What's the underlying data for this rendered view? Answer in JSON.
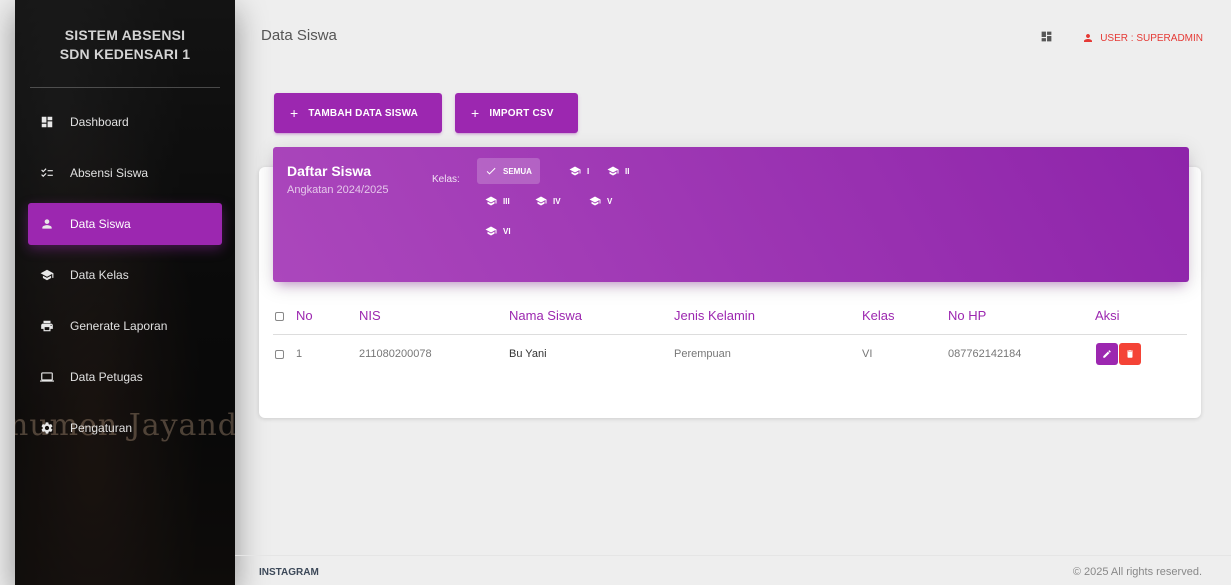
{
  "sidebar": {
    "brand_line1": "SISTEM ABSENSI",
    "brand_line2": "SDN KEDENSARI 1",
    "watermark": "numen Jayand",
    "items": [
      {
        "label": "Dashboard",
        "icon": "dashboard-icon"
      },
      {
        "label": "Absensi Siswa",
        "icon": "checklist-icon"
      },
      {
        "label": "Data Siswa",
        "icon": "person-icon",
        "active": true
      },
      {
        "label": "Data Kelas",
        "icon": "school-icon"
      },
      {
        "label": "Generate Laporan",
        "icon": "print-icon"
      },
      {
        "label": "Data Petugas",
        "icon": "laptop-icon"
      },
      {
        "label": "Pengaturan",
        "icon": "gear-icon"
      }
    ]
  },
  "header": {
    "title": "Data Siswa",
    "user_label": "USER : SUPERADMIN"
  },
  "toolbar": {
    "add_label": "TAMBAH DATA SISWA",
    "import_label": "IMPORT CSV"
  },
  "card": {
    "title": "Daftar Siswa",
    "subtitle": "Angkatan 2024/2025",
    "kelas_label": "Kelas:",
    "tabs": [
      "SEMUA",
      "I",
      "II",
      "III",
      "IV",
      "V",
      "VI"
    ],
    "active_tab": "SEMUA"
  },
  "table": {
    "headers": [
      "No",
      "NIS",
      "Nama Siswa",
      "Jenis Kelamin",
      "Kelas",
      "No HP",
      "Aksi"
    ],
    "rows": [
      {
        "no": "1",
        "nis": "211080200078",
        "nama": "Bu Yani",
        "jk": "Perempuan",
        "kelas": "VI",
        "hp": "087762142184"
      }
    ]
  },
  "footer": {
    "left": "INSTAGRAM",
    "right": "© 2025 All rights reserved."
  },
  "colors": {
    "accent": "#9c27b0",
    "danger": "#f44336"
  }
}
